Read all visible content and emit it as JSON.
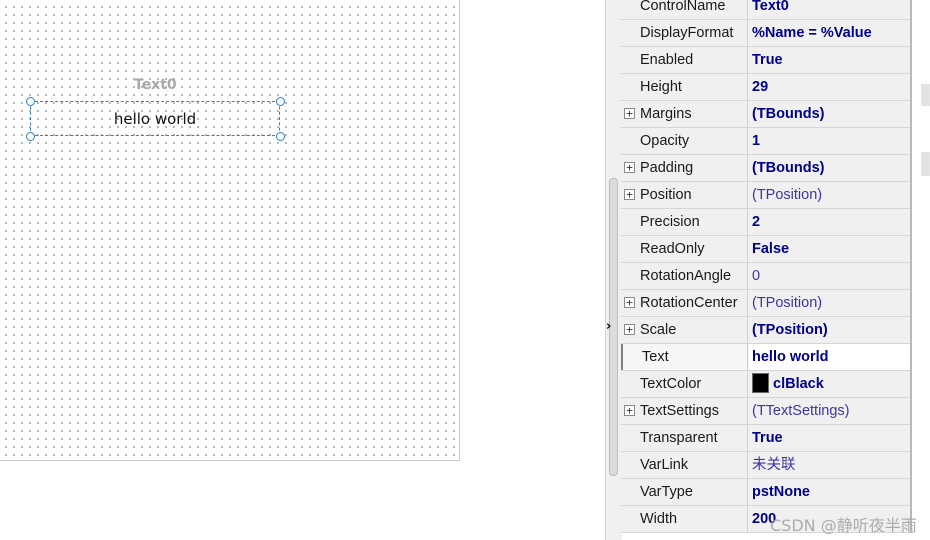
{
  "canvas": {
    "control_name": "Text0",
    "control_text": "hello world"
  },
  "properties": [
    {
      "name": "ControlName",
      "value": "Text0",
      "expandable": false,
      "style": "bold"
    },
    {
      "name": "DisplayFormat",
      "value": "%Name = %Value",
      "expandable": false,
      "style": "bold"
    },
    {
      "name": "Enabled",
      "value": "True",
      "expandable": false,
      "style": "bold"
    },
    {
      "name": "Height",
      "value": "29",
      "expandable": false,
      "style": "bold"
    },
    {
      "name": "Margins",
      "value": "(TBounds)",
      "expandable": true,
      "style": "bold"
    },
    {
      "name": "Opacity",
      "value": "1",
      "expandable": false,
      "style": "bold"
    },
    {
      "name": "Padding",
      "value": "(TBounds)",
      "expandable": true,
      "style": "bold"
    },
    {
      "name": "Position",
      "value": "(TPosition)",
      "expandable": true,
      "style": "normal"
    },
    {
      "name": "Precision",
      "value": "2",
      "expandable": false,
      "style": "bold"
    },
    {
      "name": "ReadOnly",
      "value": "False",
      "expandable": false,
      "style": "bold"
    },
    {
      "name": "RotationAngle",
      "value": "0",
      "expandable": false,
      "style": "normal"
    },
    {
      "name": "RotationCenter",
      "value": "(TPosition)",
      "expandable": true,
      "style": "normal"
    },
    {
      "name": "Scale",
      "value": "(TPosition)",
      "expandable": true,
      "style": "bold"
    },
    {
      "name": "Text",
      "value": "hello world",
      "expandable": false,
      "style": "bold",
      "selected": true
    },
    {
      "name": "TextColor",
      "value": "clBlack",
      "expandable": false,
      "style": "bold",
      "swatch": "#000000"
    },
    {
      "name": "TextSettings",
      "value": "(TTextSettings)",
      "expandable": true,
      "style": "normal"
    },
    {
      "name": "Transparent",
      "value": "True",
      "expandable": false,
      "style": "bold"
    },
    {
      "name": "VarLink",
      "value": "未关联",
      "expandable": false,
      "style": "normal"
    },
    {
      "name": "VarType",
      "value": "pstNone",
      "expandable": false,
      "style": "bold"
    },
    {
      "name": "Width",
      "value": "200",
      "expandable": false,
      "style": "bold"
    }
  ],
  "splitter": {
    "arrow": "›"
  },
  "watermark": "CSDN @静听夜半雨",
  "colors": {
    "value_text": "#00008b",
    "selection_border": "#2f7fd1",
    "grid_background": "#f0f0f0"
  }
}
